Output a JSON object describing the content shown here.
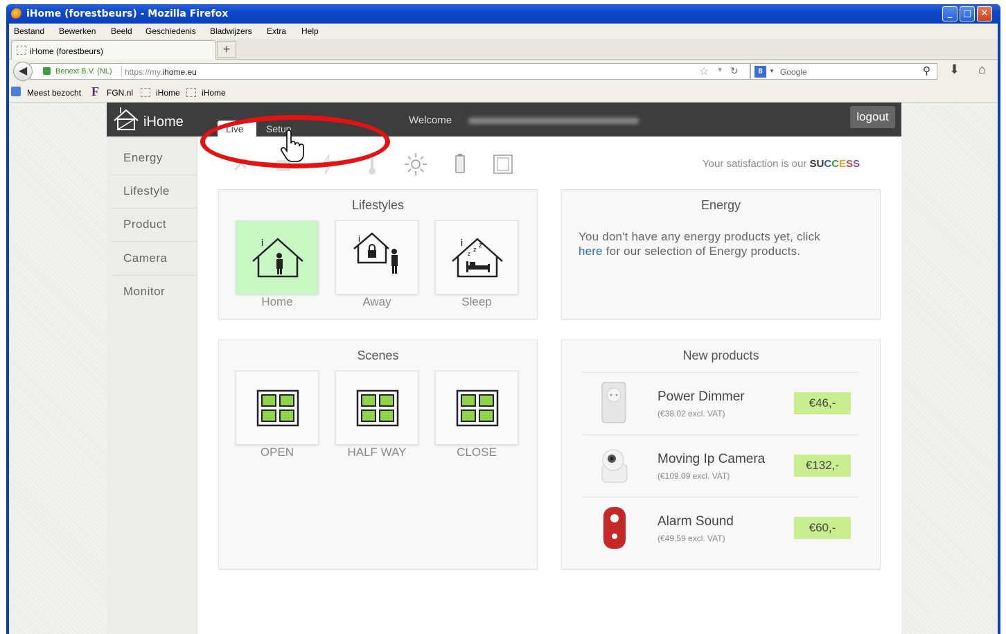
{
  "window": {
    "title": "iHome (forestbeurs) - Mozilla Firefox"
  },
  "menubar": [
    "Bestand",
    "Bewerken",
    "Beeld",
    "Geschiedenis",
    "Bladwijzers",
    "Extra",
    "Help"
  ],
  "tab": {
    "label": "iHome (forestbeurs)",
    "new_tab": "+"
  },
  "urlbar": {
    "identity": "Benext B.V. (NL)",
    "url_prefix": "https://my.",
    "url_host": "ihome.eu",
    "search_placeholder": "Google"
  },
  "bookmarks": [
    "Meest bezocht",
    "FGN.nl",
    "iHome",
    "iHome"
  ],
  "header": {
    "brand": "iHome",
    "tab_live": "Live",
    "tab_setup": "Setup",
    "welcome": "Welcome",
    "logout": "logout"
  },
  "sidebar": [
    "Energy",
    "Lifestyle",
    "Product",
    "Camera",
    "Monitor"
  ],
  "tagline": {
    "prefix": "Your satisfaction is our ",
    "highlight": "SUCCESS"
  },
  "lifestyles": {
    "title": "Lifestyles",
    "items": [
      "Home",
      "Away",
      "Sleep"
    ],
    "active": "Home"
  },
  "energy": {
    "title": "Energy",
    "text_before": "You don't have any energy products yet, click",
    "link": "here",
    "text_after": " for our selection of Energy products."
  },
  "scenes": {
    "title": "Scenes",
    "items": [
      "OPEN",
      "HALF WAY",
      "CLOSE"
    ]
  },
  "new_products": {
    "title": "New products",
    "items": [
      {
        "name": "Power Dimmer",
        "excl": "(€38.02 excl. VAT)",
        "price": "€46,-"
      },
      {
        "name": "Moving Ip Camera",
        "excl": "(€109.09 excl. VAT)",
        "price": "€132,-"
      },
      {
        "name": "Alarm Sound",
        "excl": "(€49.59 excl. VAT)",
        "price": "€60,-"
      }
    ]
  },
  "colors": {
    "active_tile": "#c9f7c3",
    "price_bg": "#c9ee8f",
    "annotation": "#e41212",
    "link": "#2a6fbd"
  },
  "icons": [
    "firefox-icon",
    "back-arrow-icon",
    "lock-icon",
    "star-icon",
    "reload-icon",
    "google-icon",
    "search-icon",
    "download-icon",
    "home-icon",
    "house-logo-icon",
    "tools-icon",
    "battery-icon",
    "sun-icon",
    "film-icon",
    "hand-cursor-icon"
  ]
}
